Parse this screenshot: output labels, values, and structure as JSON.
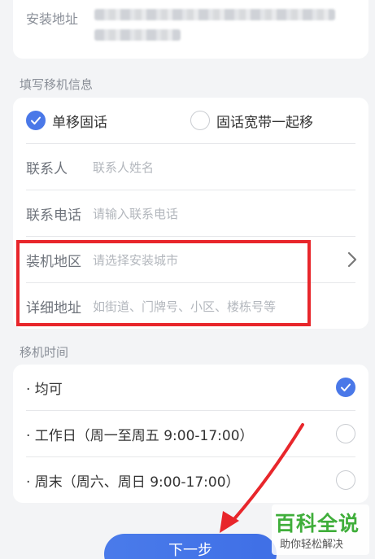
{
  "install_address": {
    "label": "安装地址"
  },
  "move_info": {
    "section_title": "填写移机信息",
    "options": [
      {
        "label": "单移固话",
        "selected": true
      },
      {
        "label": "固话宽带一起移",
        "selected": false
      }
    ],
    "contact_label": "联系人",
    "contact_placeholder": "联系人姓名",
    "phone_label": "联系电话",
    "phone_placeholder": "请输入联系电话",
    "region_label": "装机地区",
    "region_placeholder": "请选择安装城市",
    "detail_label": "详细地址",
    "detail_placeholder": "如街道、门牌号、小区、楼栋号等"
  },
  "move_time": {
    "section_title": "移机时间",
    "options": [
      {
        "label": "· 均可",
        "selected": true
      },
      {
        "label": "· 工作日（周一至周五 9:00-17:00）",
        "selected": false
      },
      {
        "label": "· 周末（周六、周日 9:00-17:00）",
        "selected": false
      }
    ]
  },
  "next_button": "下一步",
  "watermark": {
    "title": "百科全说",
    "subtitle": "助你轻松解决"
  },
  "colors": {
    "accent": "#4a78e8",
    "highlight_box": "#e8262b",
    "watermark_green": "#3fae3a"
  }
}
